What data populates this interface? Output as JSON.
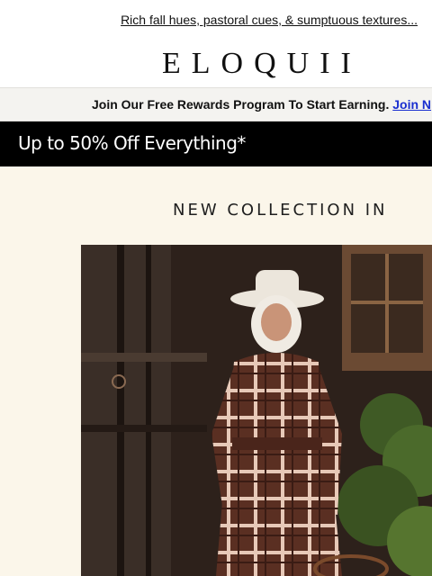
{
  "preheader": {
    "text": "Rich fall hues, pastoral cues, & sumptuous textures..."
  },
  "brand": {
    "logo": "ELOQUII"
  },
  "rewards": {
    "text": "Join Our Free Rewards Program To Start Earning.",
    "link": "Join N"
  },
  "promo": {
    "text": "Up to 50% Off Everything*"
  },
  "collection": {
    "heading": "NEW COLLECTION IN"
  },
  "colors": {
    "promo_bg": "#000000",
    "collection_bg": "#fbf6ea",
    "link_blue": "#1a2fd0",
    "plaid_brown": "#5a2f22"
  }
}
